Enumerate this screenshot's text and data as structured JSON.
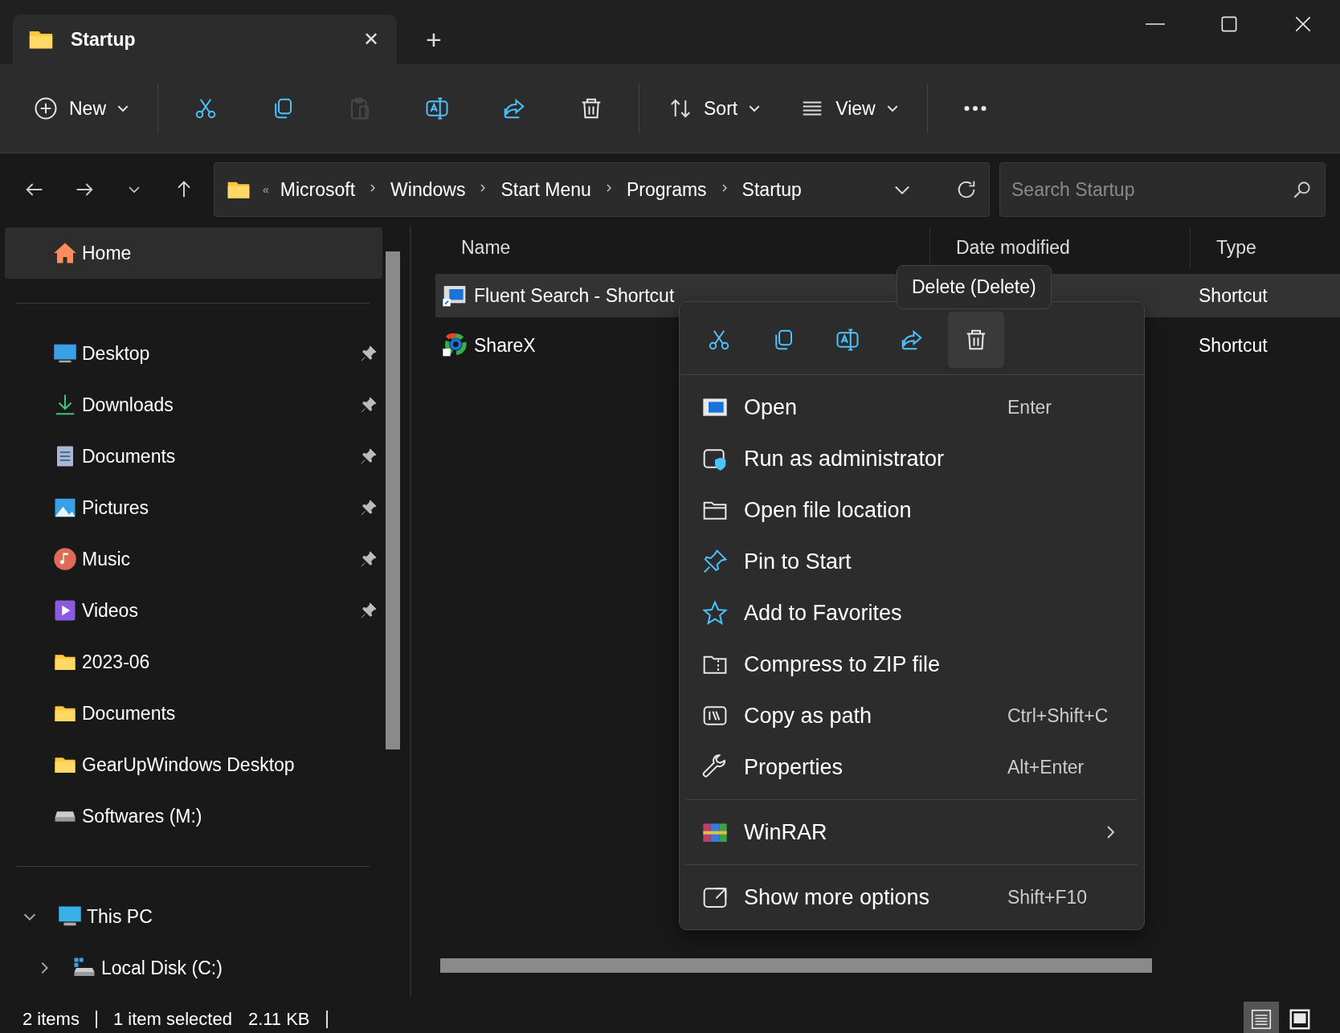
{
  "tab": {
    "title": "Startup",
    "close": "✕",
    "new": "+"
  },
  "toolbar": [
    {
      "label": "New",
      "caret": true,
      "disabled": false
    },
    {
      "disabled": false
    },
    {
      "disabled": false
    },
    {
      "disabled": true
    },
    {
      "disabled": false
    },
    {
      "disabled": false
    },
    {
      "disabled": false
    },
    {
      "label": "Sort",
      "caret": true,
      "disabled": false
    },
    {
      "label": "View",
      "caret": true,
      "disabled": false
    },
    {
      "disabled": false
    }
  ],
  "address": {
    "overflow": "«",
    "crumbs": [
      "Microsoft",
      "Windows",
      "Start Menu",
      "Programs",
      "Startup"
    ]
  },
  "search": {
    "placeholder": "Search Startup"
  },
  "sidebar": {
    "items": [
      {
        "label": "Home",
        "selected": true,
        "pinned": false
      },
      {
        "kind": "divider"
      },
      {
        "label": "Desktop",
        "selected": false,
        "pinned": true
      },
      {
        "label": "Downloads",
        "selected": false,
        "pinned": true
      },
      {
        "label": "Documents",
        "selected": false,
        "pinned": true
      },
      {
        "label": "Pictures",
        "selected": false,
        "pinned": true
      },
      {
        "label": "Music",
        "selected": false,
        "pinned": true
      },
      {
        "label": "Videos",
        "selected": false,
        "pinned": true
      },
      {
        "label": "2023-06",
        "selected": false,
        "pinned": false
      },
      {
        "label": "Documents",
        "selected": false,
        "pinned": false
      },
      {
        "label": "GearUpWindows Desktop",
        "selected": false,
        "pinned": false
      },
      {
        "label": "Softwares (M:)",
        "selected": false,
        "pinned": false
      },
      {
        "kind": "divider"
      },
      {
        "label": "This PC",
        "selected": false,
        "pinned": false,
        "expanded": true,
        "children": [
          {
            "label": "Local Disk (C:)",
            "selected": false,
            "pinned": false,
            "expanded": false
          }
        ]
      }
    ]
  },
  "table": {
    "columns": [
      "Name",
      "Date modified",
      "Type"
    ],
    "rows": [
      {
        "name": "Fluent Search - Shortcut",
        "type": "Shortcut",
        "selected": true
      },
      {
        "name": "ShareX",
        "type": "Shortcut",
        "selected": false
      }
    ]
  },
  "tooltip": "Delete (Delete)",
  "context_menu": {
    "quick_actions": [
      {
        "hovered": false
      },
      {
        "hovered": false
      },
      {
        "hovered": false
      },
      {
        "hovered": false
      },
      {
        "hovered": true
      }
    ],
    "items": [
      {
        "kind": "item",
        "label": "Open",
        "shortcut": "Enter"
      },
      {
        "kind": "item",
        "label": "Run as administrator"
      },
      {
        "kind": "item",
        "label": "Open file location"
      },
      {
        "kind": "item",
        "label": "Pin to Start"
      },
      {
        "kind": "item",
        "label": "Add to Favorites"
      },
      {
        "kind": "item",
        "label": "Compress to ZIP file"
      },
      {
        "kind": "item",
        "label": "Copy as path",
        "shortcut": "Ctrl+Shift+C"
      },
      {
        "kind": "item",
        "label": "Properties",
        "shortcut": "Alt+Enter"
      },
      {
        "kind": "separator"
      },
      {
        "kind": "submenu",
        "label": "WinRAR"
      },
      {
        "kind": "separator"
      },
      {
        "kind": "item",
        "label": "Show more options",
        "shortcut": "Shift+F10"
      }
    ]
  },
  "status_bar": {
    "items": [
      "2 items",
      "1 item selected",
      "2.11 KB"
    ],
    "views": [
      {
        "selected": true
      },
      {
        "selected": false
      }
    ]
  }
}
